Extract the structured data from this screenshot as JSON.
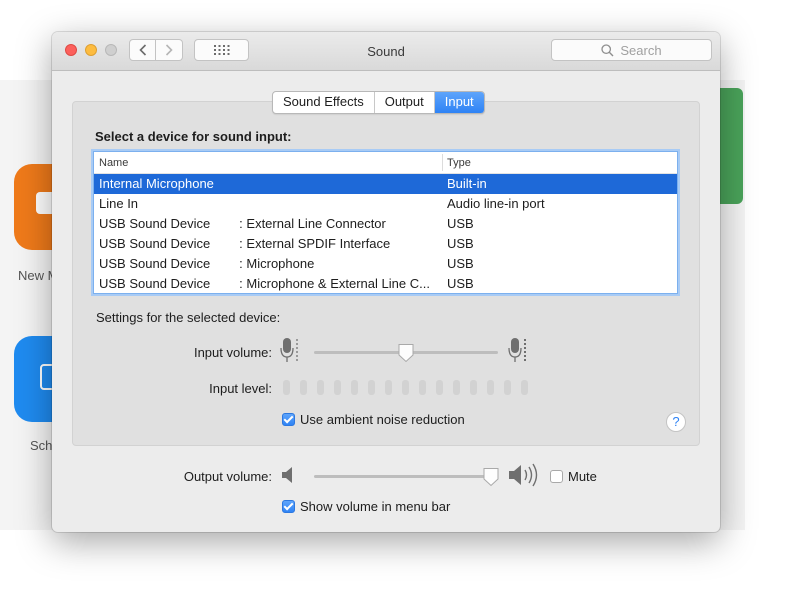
{
  "background_app": {
    "tile_labels": [
      "New M",
      "Sch"
    ]
  },
  "window": {
    "title": "Sound",
    "search_placeholder": "Search",
    "nav": {
      "back_icon": "chevron-left-icon",
      "forward_icon": "chevron-right-icon",
      "grid_icon": "grid-icon"
    }
  },
  "tabs": [
    {
      "label": "Sound Effects",
      "active": false
    },
    {
      "label": "Output",
      "active": false
    },
    {
      "label": "Input",
      "active": true
    }
  ],
  "input": {
    "section_title": "Select a device for sound input:",
    "columns": {
      "name": "Name",
      "type": "Type"
    },
    "devices": [
      {
        "name": "Internal Microphone",
        "type": "Built-in",
        "selected": true
      },
      {
        "name": "Line In",
        "type": "Audio line-in port",
        "selected": false
      },
      {
        "name": "USB Sound Device        : External Line Connector",
        "type": "USB",
        "selected": false
      },
      {
        "name": "USB Sound Device        : External SPDIF Interface",
        "type": "USB",
        "selected": false
      },
      {
        "name": "USB Sound Device        : Microphone",
        "type": "USB",
        "selected": false
      },
      {
        "name": "USB Sound Device        : Microphone & External Line C...",
        "type": "USB",
        "selected": false
      }
    ],
    "settings_label": "Settings for the selected device:",
    "input_volume_label": "Input volume:",
    "input_volume_level": 0.5,
    "input_level_label": "Input level:",
    "input_level_segments": 15,
    "ambient_noise_label": "Use ambient noise reduction",
    "ambient_noise_checked": true,
    "help_label": "?"
  },
  "output": {
    "output_volume_label": "Output volume:",
    "output_volume_level": 0.96,
    "mute_label": "Mute",
    "mute_checked": false,
    "show_volume_label": "Show volume in menu bar",
    "show_volume_checked": true
  },
  "colors": {
    "accent": "#2f83f5",
    "selection": "#1e69d8"
  }
}
